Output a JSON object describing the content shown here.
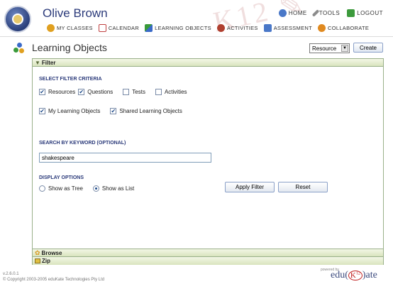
{
  "header": {
    "user_name": "Olive Brown",
    "top_links": [
      {
        "label": "HOME",
        "icon": "home-icon"
      },
      {
        "label": "TOOLS",
        "icon": "tools-icon"
      },
      {
        "label": "LOGOUT",
        "icon": "logout-icon"
      }
    ],
    "nav": [
      {
        "label": "MY CLASSES",
        "icon": "classes-icon"
      },
      {
        "label": "CALENDAR",
        "icon": "calendar-icon"
      },
      {
        "label": "LEARNING OBJECTS",
        "icon": "learning-objects-icon"
      },
      {
        "label": "ACTIVITIES",
        "icon": "activities-icon"
      },
      {
        "label": "ASSESSMENT",
        "icon": "assessment-icon"
      },
      {
        "label": "COLLABORATE",
        "icon": "collaborate-icon"
      }
    ]
  },
  "page": {
    "title": "Learning Objects",
    "type_select_value": "Resource",
    "create_label": "Create"
  },
  "panel": {
    "filter_label": "Filter",
    "select_criteria_label": "SELECT FILTER CRITERIA",
    "types": [
      {
        "label": "Resources",
        "checked": true
      },
      {
        "label": "Questions",
        "checked": true
      },
      {
        "label": "Tests",
        "checked": false
      },
      {
        "label": "Activities",
        "checked": false
      }
    ],
    "ownership": [
      {
        "label": "My Learning Objects",
        "checked": true
      },
      {
        "label": "Shared Learning Objects",
        "checked": true
      }
    ],
    "keyword_label": "SEARCH BY KEYWORD (OPTIONAL)",
    "keyword_value": "shakespeare",
    "display_label": "DISPLAY OPTIONS",
    "display_options": [
      {
        "label": "Show as Tree",
        "selected": false
      },
      {
        "label": "Show as List",
        "selected": true
      }
    ],
    "apply_label": "Apply Filter",
    "reset_label": "Reset",
    "browse_label": "Browse",
    "zip_label": "Zip"
  },
  "footer": {
    "version": "v.2.6.0.1",
    "copyright": "© Copyright 2003-2005 eduKate Technologies Pty Ltd",
    "powered_by": "powered by",
    "brand_prefix": "edu(",
    "brand_k": "K",
    "brand_12": "12",
    "brand_suffix": ")ate"
  },
  "colors": {
    "accent": "#2b3a7a",
    "panel_border": "#9ab08a",
    "panel_header": "#d9e4be"
  }
}
